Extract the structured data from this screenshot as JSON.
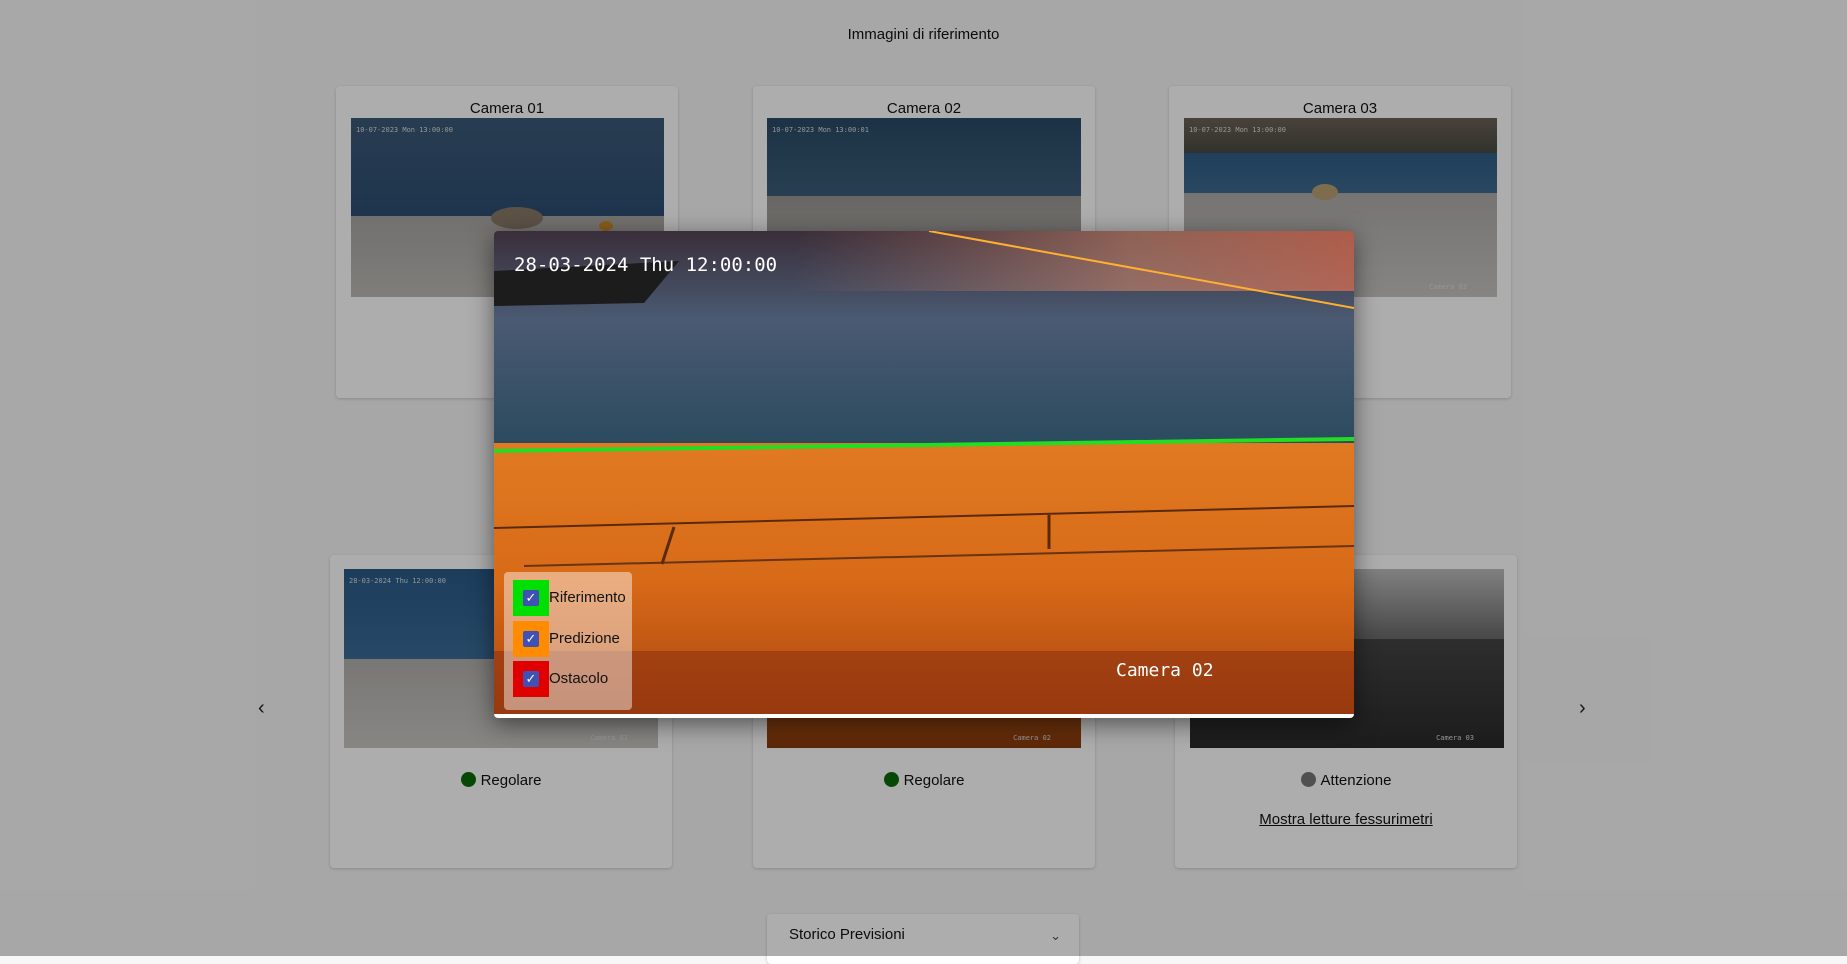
{
  "page": {
    "section_title": "Immagini di riferimento"
  },
  "reference_cards": [
    {
      "title": "Camera 01",
      "timestamp": "10-07-2023 Mon 13:00:00",
      "label": ""
    },
    {
      "title": "Camera 02",
      "timestamp": "10-07-2023 Mon 13:00:01",
      "label": ""
    },
    {
      "title": "Camera 03",
      "timestamp": "10-07-2023 Mon 13:00:00",
      "label": "Camera 03"
    }
  ],
  "live_cards": [
    {
      "timestamp": "28-03-2024 Thu 12:00:00",
      "label": "Camera 01",
      "status": "Regolare",
      "status_color": "#0b6b0b"
    },
    {
      "timestamp": "",
      "label": "Camera 02",
      "status": "Regolare",
      "status_color": "#0b6b0b"
    },
    {
      "timestamp": "",
      "label": "Camera 03",
      "status": "Attenzione",
      "status_color": "#777777",
      "link": "Mostra letture fessurimetri"
    }
  ],
  "nav": {
    "prev_icon": "chevron-left-icon",
    "next_icon": "chevron-right-icon",
    "prev_glyph": "‹",
    "next_glyph": "›"
  },
  "modal": {
    "timestamp": "28-03-2024 Thu 12:00:00",
    "camera_label": "Camera 02",
    "legend": [
      {
        "label": "Riferimento",
        "color": "#00e000",
        "checked": true
      },
      {
        "label": "Predizione",
        "color": "#ff8c00",
        "checked": true
      },
      {
        "label": "Ostacolo",
        "color": "#e00000",
        "checked": true
      }
    ]
  },
  "accordion": {
    "label": "Storico Previsioni",
    "chevron": "⌄"
  }
}
